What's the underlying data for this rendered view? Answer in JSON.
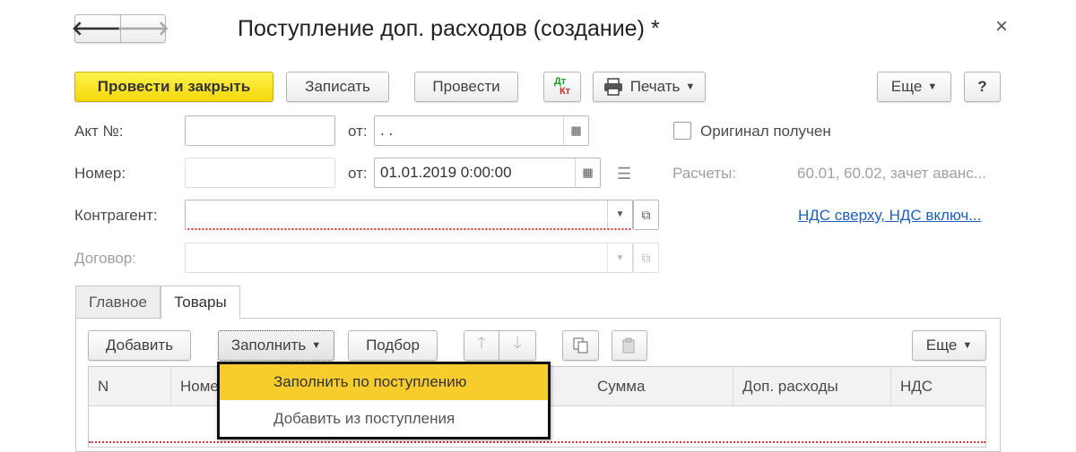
{
  "window": {
    "title": "Поступление доп. расходов (создание) *",
    "close_glyph": "×",
    "back_glyph": "🡐",
    "forward_glyph": "🡒"
  },
  "toolbar": {
    "post_close": "Провести и закрыть",
    "save": "Записать",
    "post": "Провести",
    "dt": "Дт",
    "kt": "Кт",
    "print": "Печать",
    "more": "Еще",
    "help": "?"
  },
  "form": {
    "act_label": "Акт №:",
    "act_value": "",
    "from_label": "от:",
    "act_date": " .  .",
    "original_label": "Оригинал получен",
    "number_label": "Номер:",
    "number_value": "",
    "date_value": "01.01.2019  0:00:00",
    "settlements_label": "Расчеты:",
    "settlements_value": "60.01, 60.02, зачет аванс...",
    "counterparty_label": "Контрагент:",
    "counterparty_value": "",
    "vat_link": "НДС сверху, НДС включ...",
    "contract_label": "Договор:",
    "contract_value": ""
  },
  "tabs": [
    {
      "label": "Главное"
    },
    {
      "label": "Товары"
    }
  ],
  "table_toolbar": {
    "add": "Добавить",
    "fill": "Заполнить",
    "pick": "Подбор",
    "more": "Еще"
  },
  "table": {
    "columns": [
      "N",
      "Номе",
      "Сумма",
      "Доп. расходы",
      "НДС"
    ]
  },
  "dropdown": {
    "items": [
      "Заполнить по поступлению",
      "Добавить из поступления"
    ]
  },
  "colors": {
    "primary_button": "#f5d80a",
    "highlight_item": "#f7cd2e",
    "link": "#1f5fbf",
    "required_marker": "#d33333"
  }
}
